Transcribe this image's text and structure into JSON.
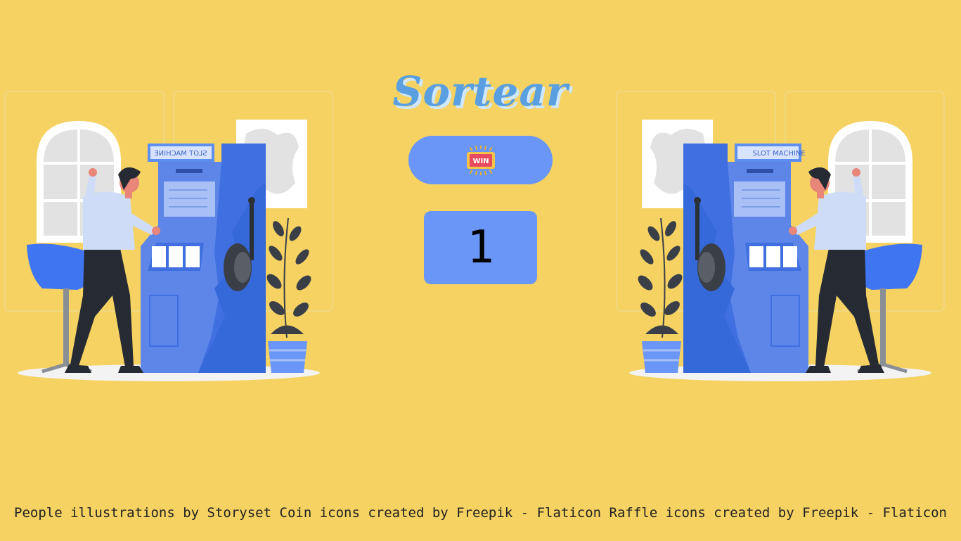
{
  "title": "Sortear",
  "draw_button": {
    "icon": "win-ticket-icon",
    "label": "WIN"
  },
  "result": {
    "value": "1"
  },
  "illustration": {
    "sign_text": "SLOT MACHINE"
  },
  "credits": [
    "People illustrations by Storyset",
    "Coin icons created by Freepik - Flaticon",
    "Raffle icons created by Freepik - Flaticon"
  ],
  "colors": {
    "background": "#f5d262",
    "accent": "#6a96f7",
    "title": "#5aa0e0"
  }
}
